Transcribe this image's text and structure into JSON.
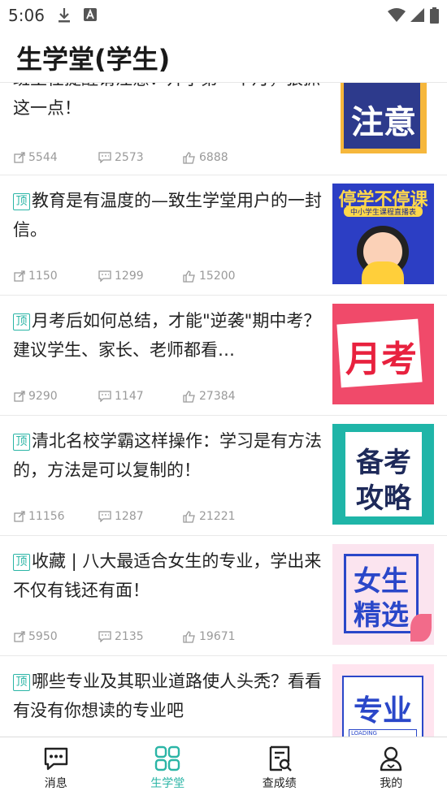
{
  "status_bar": {
    "time": "5:06",
    "icons": [
      "download-icon",
      "a-icon",
      "wifi-icon",
      "signal-icon",
      "battery-icon"
    ]
  },
  "header": {
    "title": "生学堂(学生)"
  },
  "colors": {
    "accent": "#2bb5a6",
    "text": "#222222",
    "muted": "#9a9a9a"
  },
  "articles": [
    {
      "top_badge": "",
      "title": "班主任提醒请注意：开学第一个月，狠抓这一点！",
      "shares": "5544",
      "comments": "2573",
      "likes": "6888",
      "thumbnail_text": "注意"
    },
    {
      "top_badge": "顶",
      "title": "教育是有温度的—致生学堂用户的一封信。",
      "shares": "1150",
      "comments": "1299",
      "likes": "15200",
      "thumbnail_text": "停学不停课",
      "thumbnail_subtext": "中小学生课程直播表"
    },
    {
      "top_badge": "顶",
      "title": "月考后如何总结，才能\"逆袭\"期中考？建议学生、家长、老师都看…",
      "shares": "9290",
      "comments": "1147",
      "likes": "27384",
      "thumbnail_text": "月考"
    },
    {
      "top_badge": "顶",
      "title": "清北名校学霸这样操作：学习是有方法的，方法是可以复制的！",
      "shares": "11156",
      "comments": "1287",
      "likes": "21221",
      "thumbnail_text_1": "备考",
      "thumbnail_text_2": "攻略"
    },
    {
      "top_badge": "顶",
      "title": "收藏 | 八大最适合女生的专业，学出来不仅有钱还有面！",
      "shares": "5950",
      "comments": "2135",
      "likes": "19671",
      "thumbnail_text_1": "女生",
      "thumbnail_text_2": "精选"
    },
    {
      "top_badge": "顶",
      "title": "哪些专业及其职业道路使人头秃？看看有没有你想读的专业吧",
      "shares": "",
      "comments": "",
      "likes": "",
      "thumbnail_text": "专业",
      "thumbnail_subtext": "LOADING"
    }
  ],
  "bottom_nav": [
    {
      "label": "消息",
      "icon": "message-icon",
      "active": false
    },
    {
      "label": "生学堂",
      "icon": "grid-icon",
      "active": true
    },
    {
      "label": "查成绩",
      "icon": "search-document-icon",
      "active": false
    },
    {
      "label": "我的",
      "icon": "user-icon",
      "active": false
    }
  ]
}
